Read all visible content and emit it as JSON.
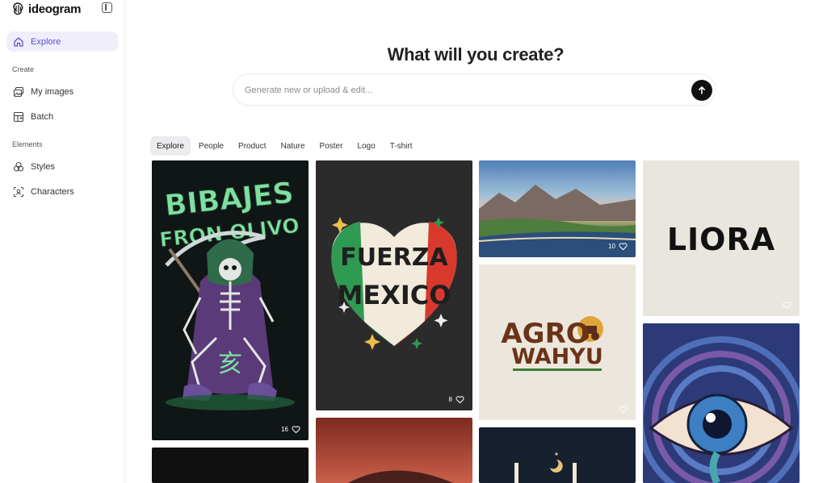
{
  "brand": {
    "name": "ideogram"
  },
  "sidebar": {
    "explore": "Explore",
    "create_label": "Create",
    "my_images": "My images",
    "batch": "Batch",
    "elements_label": "Elements",
    "styles": "Styles",
    "characters": "Characters"
  },
  "main": {
    "headline": "What will you create?",
    "prompt_placeholder": "Generate new or upload & edit...",
    "tabs": [
      "Explore",
      "People",
      "Product",
      "Nature",
      "Poster",
      "Logo",
      "T-shirt"
    ],
    "active_tab": "Explore"
  },
  "gallery": {
    "card1": {
      "text_line1": "BIBAJES",
      "text_line2": "FRON OLIVO",
      "glyph": "亥",
      "likes": "16"
    },
    "card2": {
      "text_line1": "FUERZA",
      "text_line2": "MEXICO",
      "likes": "8"
    },
    "card3": {
      "likes": "10"
    },
    "card4": {
      "logo_text": "LIORA"
    },
    "card5": {
      "text_line1": "AGRO",
      "text_line2": "WAHYU"
    }
  },
  "colors": {
    "accent": "#5b4dd0",
    "active_nav_bg": "#efeefa",
    "ink": "#222222"
  }
}
